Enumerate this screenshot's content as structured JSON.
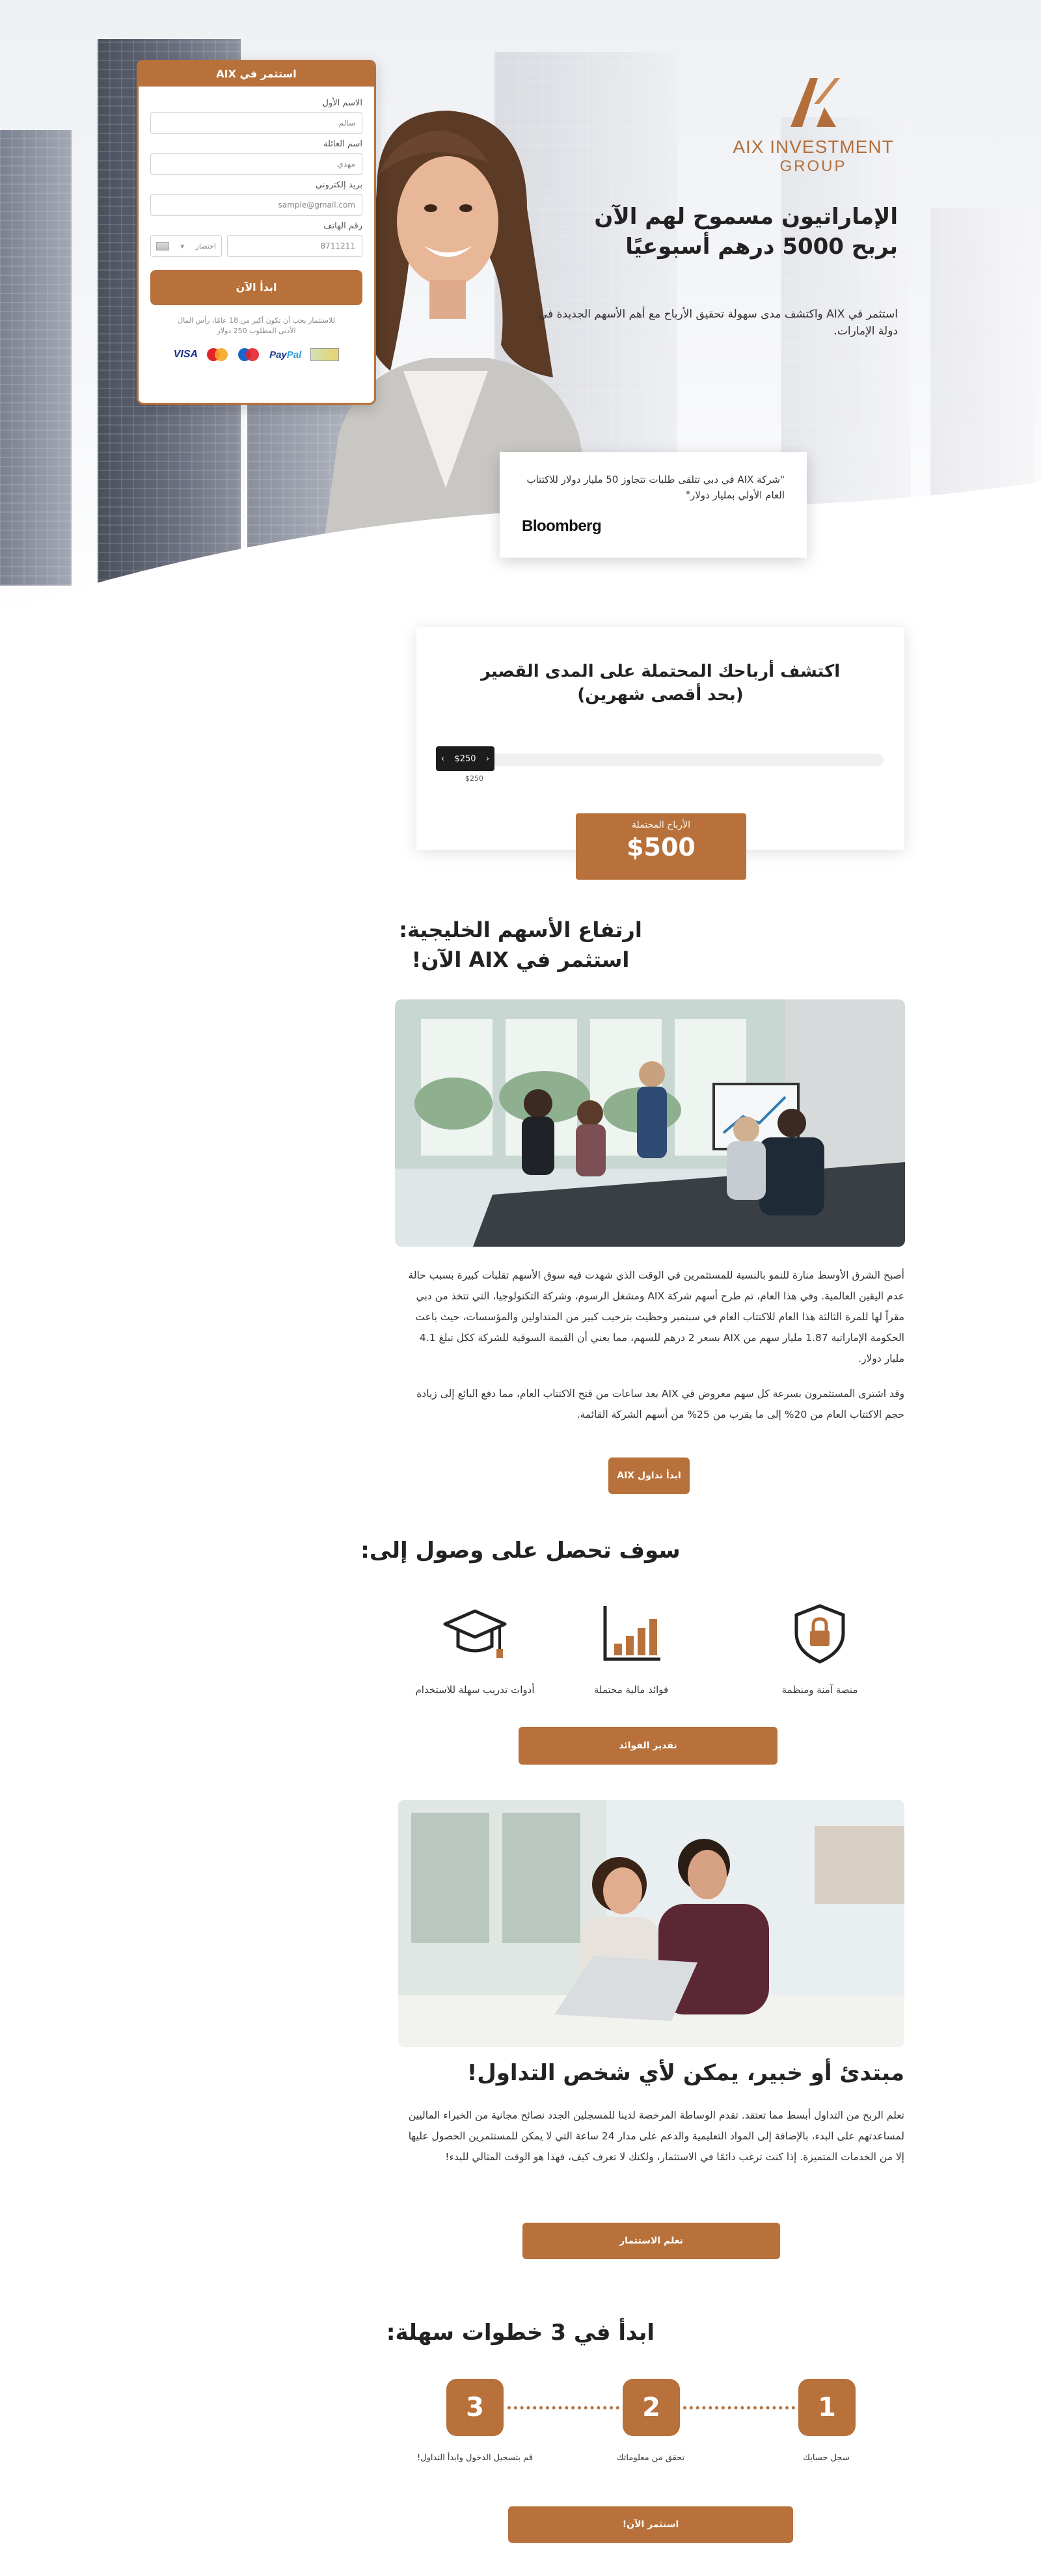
{
  "logo": {
    "name": "AIX INVESTMENT",
    "sub": "GROUP"
  },
  "hero": {
    "title": "الإماراتيون مسموح لهم الآن بربح 5000 درهم أسبوعيًا",
    "subtitle": "استثمر في AIX واكتشف مدى سهولة تحقيق الأرباح مع أهم الأسهم الجديدة في دولة الإمارات."
  },
  "quote": {
    "text": "\"شركة AIX في دبي تتلقى طلبات تتجاوز 50 مليار دولار للاكتتاب العام الأولي بمليار دولار\"",
    "brand": "Bloomberg"
  },
  "form": {
    "title": "استثمر في AIX",
    "first_name_label": "الاسم الأول",
    "first_name_placeholder": "سالم",
    "last_name_label": "اسم العائلة",
    "last_name_placeholder": "مهدي",
    "email_label": "بريد إلكتروني",
    "email_placeholder": "sample@gmail.com",
    "phone_label": "رقم الهاتف",
    "phone_code": "اختصار",
    "phone_placeholder": "8711211",
    "submit": "ابدأ الآن",
    "note": "للاستثمار يجب أن تكون أكبر من 18 عامًا، رأس المال الأدنى المطلوب 250 دولار",
    "payments": {
      "visa": "VISA",
      "paypal_a": "Pay",
      "paypal_b": "Pal"
    }
  },
  "calculator": {
    "title_line1": "اكتشف أرباحك المحتملة على المدى القصير",
    "title_line2": "(بحد أقصى شهرين)",
    "slider_value": "$250",
    "slider_min": "$250",
    "slider_fraction": 0.0,
    "profit_label": "الأرباح المحتملة",
    "profit_value": "$500"
  },
  "section_gulf": {
    "title_line1": "ارتفاع الأسهم الخليجية:",
    "title_line2": "استثمر في AIX الآن!",
    "para1": "أصبح الشرق الأوسط منارة للنمو بالنسبة للمستثمرين في الوقت الذي شهدت فيه سوق الأسهم تقلبات كبيرة بسبب حالة عدم اليقين العالمية. وفي هذا العام، تم طرح أسهم شركة AIX ومشغل الرسوم، وشركة التكنولوجيا، التي تتخذ من دبي مقراً لها للمرة الثالثة هذا العام للاكتتاب العام في سبتمبر وحظيت بترحيب كبير من المتداولين والمؤسسات، حيث باعت الحكومة الإماراتية 1.87 مليار سهم من AIX بسعر 2 درهم للسهم، مما يعني أن القيمة السوقية للشركة ككل تبلغ 4.1 مليار دولار.",
    "para2": "وقد اشترى المستثمرون بسرعة كل سهم معروض في AIX بعد ساعات من فتح الاكتتاب العام، مما دفع البائع إلى زيادة حجم الاكتتاب العام من 20% إلى ما يقرب من 25% من أسهم الشركة القائمة.",
    "button": "ابدأ تداول AIX"
  },
  "benefits": {
    "title": "سوف تحصل على وصول إلى:",
    "items": [
      {
        "label": "منصة آمنة ومنظمة",
        "icon": "shield-lock-icon"
      },
      {
        "label": "فوائد مالية محتملة",
        "icon": "bar-chart-icon"
      },
      {
        "label": "أدوات تدريب سهلة للاستخدام",
        "icon": "graduation-cap-icon"
      }
    ],
    "button": "تقدير الفوائد"
  },
  "beginner": {
    "title": "مبتدئ أو خبير، يمكن لأي شخص التداول!",
    "para": "تعلم الربح من التداول أبسط مما تعتقد. تقدم الوساطة المرخصة لدينا للمسجلين الجدد نصائح مجانية من الخبراء الماليين لمساعدتهم على البدء، بالإضافة إلى المواد التعليمية والدعم على مدار 24 ساعة التي لا يمكن للمستثمرين الحصول عليها إلا من الخدمات المتميزة. إذا كنت ترغب دائمًا في الاستثمار، ولكنك لا تعرف كيف، فهذا هو الوقت المثالي للبدء!",
    "button": "تعلم الاستثمار"
  },
  "steps": {
    "title": "ابدأ في 3 خطوات سهلة:",
    "items": [
      {
        "num": "1",
        "label": "سجل حسابك"
      },
      {
        "num": "2",
        "label": "تحقق من معلوماتك"
      },
      {
        "num": "3",
        "label": "قم بتسجيل الدخول وابدأ التداول!"
      }
    ],
    "button": "استثمر الآن!"
  },
  "colors": {
    "accent": "#b8713a",
    "dark": "#1c1c1c"
  }
}
